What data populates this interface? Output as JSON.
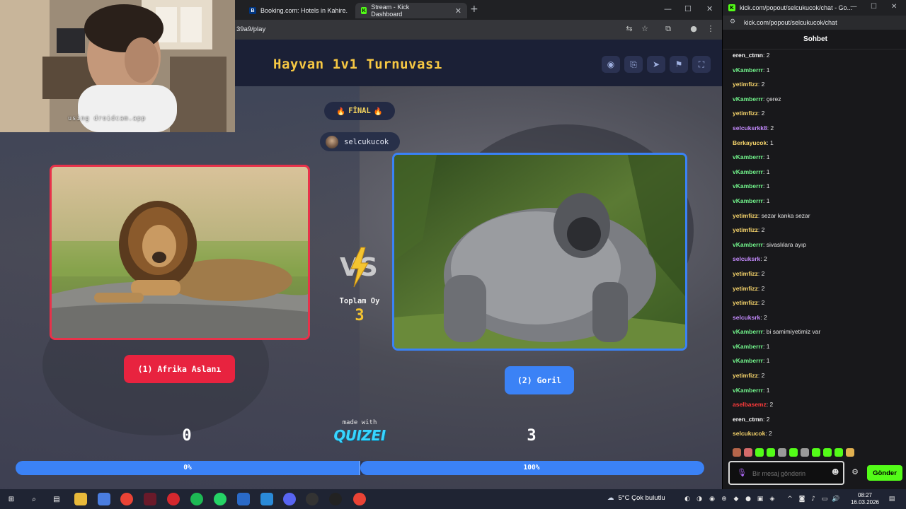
{
  "browser": {
    "tabs": [
      {
        "label": "Booking.com: Hotels in Kahire.",
        "favicon": "B",
        "favicon_color": "#003580"
      },
      {
        "label": "Stream - Kick Dashboard",
        "favicon": "K",
        "favicon_color": "#53fc18"
      }
    ],
    "url": "39a9/play"
  },
  "app": {
    "title": "Hayvan 1v1 Turnuvası",
    "final_badge": "FİNAL",
    "user": "selcukucok",
    "left_option": {
      "label": "(1) Afrika Aslanı",
      "score": "0",
      "percent": "0%",
      "color": "#e8233f"
    },
    "right_option": {
      "label": "(2) Goril",
      "score": "3",
      "percent": "100%",
      "color": "#3b82f6"
    },
    "total_label": "Toplam Oy",
    "total_value": "3",
    "made_with": "made with",
    "brand": "QUIZEI",
    "right_share": 1.0
  },
  "webcam": {
    "caption": "using droidcam.app"
  },
  "chat": {
    "window_title": "kick.com/popout/selcukucok/chat - Go...",
    "url": "kick.com/popout/selcukucok/chat",
    "header": "Sohbet",
    "messages": [
      {
        "user": "eren_ctmn",
        "text": "2",
        "color": "#ffffff"
      },
      {
        "user": "vKamberrr",
        "text": "1",
        "color": "#72f58c"
      },
      {
        "user": "yetimfizz",
        "text": "2",
        "color": "#f5d36b"
      },
      {
        "user": "vKamberrr",
        "text": "çerez",
        "color": "#72f58c"
      },
      {
        "user": "yetimfizz",
        "text": "2",
        "color": "#f5d36b"
      },
      {
        "user": "selcuksrkk8",
        "text": "2",
        "color": "#c58bff"
      },
      {
        "user": "Berkayucok",
        "text": "1",
        "color": "#f5d36b"
      },
      {
        "user": "vKamberrr",
        "text": "1",
        "color": "#72f58c"
      },
      {
        "user": "vKamberrr",
        "text": "1",
        "color": "#72f58c"
      },
      {
        "user": "vKamberrr",
        "text": "1",
        "color": "#72f58c"
      },
      {
        "user": "vKamberrr",
        "text": "1",
        "color": "#72f58c"
      },
      {
        "user": "yetimfizz",
        "text": "sezar kanka sezar",
        "color": "#f5d36b"
      },
      {
        "user": "yetimfizz",
        "text": "2",
        "color": "#f5d36b"
      },
      {
        "user": "vKamberrr",
        "text": "sivaslılara ayıp",
        "color": "#72f58c"
      },
      {
        "user": "selcuksrk",
        "text": "2",
        "color": "#c58bff"
      },
      {
        "user": "yetimfizz",
        "text": "2",
        "color": "#f5d36b"
      },
      {
        "user": "yetimfizz",
        "text": "2",
        "color": "#f5d36b"
      },
      {
        "user": "yetimfizz",
        "text": "2",
        "color": "#f5d36b"
      },
      {
        "user": "selcuksrk",
        "text": "2",
        "color": "#c58bff"
      },
      {
        "user": "vKamberrr",
        "text": "bi samimiyetimiz var",
        "color": "#72f58c"
      },
      {
        "user": "vKamberrr",
        "text": "1",
        "color": "#72f58c"
      },
      {
        "user": "vKamberrr",
        "text": "1",
        "color": "#72f58c"
      },
      {
        "user": "yetimfizz",
        "text": "2",
        "color": "#f5d36b"
      },
      {
        "user": "vKamberrr",
        "text": "1",
        "color": "#72f58c"
      },
      {
        "user": "aselbasemz",
        "text": "2",
        "color": "#ff3b3b"
      },
      {
        "user": "eren_ctmn",
        "text": "2",
        "color": "#ffffff"
      },
      {
        "user": "selcukucok",
        "text": "2",
        "color": "#f5d36b"
      }
    ],
    "input_placeholder": "Bir mesaj gönderin",
    "send_label": "Gönder"
  },
  "taskbar": {
    "weather": "5°C  Çok bulutlu",
    "time": "08:27",
    "date": "16.03.2026"
  }
}
